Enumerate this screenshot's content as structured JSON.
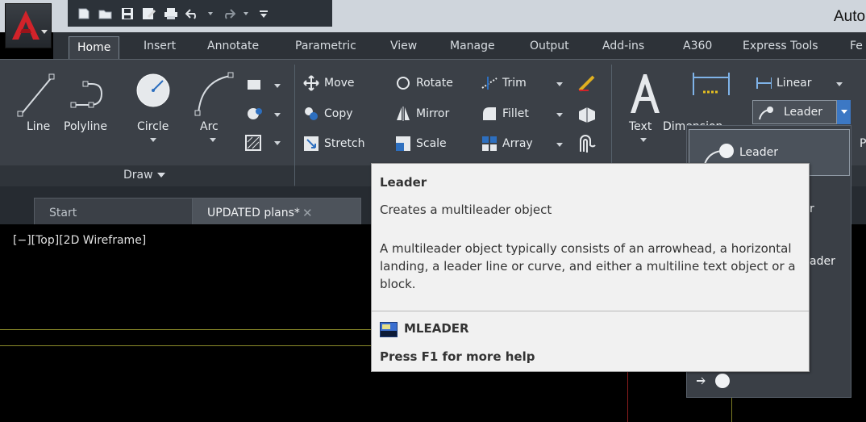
{
  "window": {
    "title": "Auto"
  },
  "quick_access": {
    "icons": [
      "new-icon",
      "open-icon",
      "save-icon",
      "save-as-icon",
      "plot-icon",
      "undo-icon",
      "redo-icon",
      "customize-icon"
    ]
  },
  "ribbon_tabs": [
    "Home",
    "Insert",
    "Annotate",
    "Parametric",
    "View",
    "Manage",
    "Output",
    "Add-ins",
    "A360",
    "Express Tools",
    "Fe"
  ],
  "draw_panel": {
    "title": "Draw",
    "tools": {
      "line": "Line",
      "polyline": "Polyline",
      "circle": "Circle",
      "arc": "Arc"
    }
  },
  "modify_panel": {
    "move": "Move",
    "rotate": "Rotate",
    "trim": "Trim",
    "copy": "Copy",
    "mirror": "Mirror",
    "fillet": "Fillet",
    "stretch": "Stretch",
    "scale": "Scale",
    "array": "Array"
  },
  "annotation_panel": {
    "text": "Text",
    "dimension": "Dimension",
    "linear": "Linear",
    "leader": "Leader",
    "cut_label": "P"
  },
  "document_tabs": [
    {
      "label": "Start"
    },
    {
      "label": "UPDATED plans*",
      "active": true
    }
  ],
  "viewport": {
    "label": "[−][Top][2D Wireframe]"
  },
  "leader_dropdown": {
    "items": [
      {
        "label": "Leader"
      },
      {
        "label": "r"
      },
      {
        "label": "ader"
      }
    ]
  },
  "tooltip": {
    "title": "Leader",
    "summary": "Creates a multileader object",
    "description": "A multileader object typically consists of an arrowhead, a horizontal landing, a leader line or curve, and either a multiline text object or a block.",
    "command": "MLEADER",
    "help": "Press F1 for more help"
  },
  "colors": {
    "ribbon_bg": "#3b4047",
    "tab_bar_bg": "#2d3238",
    "drawing_bg": "#000000",
    "tooltip_bg": "#f1f1f1",
    "accent_blue": "#3c78c4",
    "autocad_red": "#d1232a"
  }
}
